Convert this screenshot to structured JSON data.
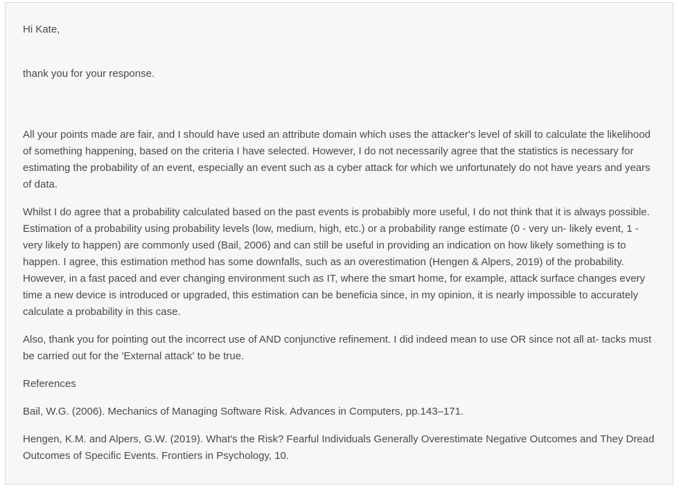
{
  "message": {
    "greeting": "Hi Kate,",
    "thanks": "thank you for your response.",
    "paragraph_1": "All your points made are fair, and I should have used an attribute domain which uses the attacker's level of skill to calculate the likelihood of something happening, based on the criteria I have selected. However, I do not necessarily agree that the statistics is necessary for estimating the probability of an event, especially an event such as a cyber attack for which we unfortunately do not have years and years of data.",
    "paragraph_2": "Whilst I do agree that a probability calculated based on the past events is probabibly more useful, I do not think that it is always possible. Estimation of a probability using probability levels (low, medium, high, etc.) or a probability range estimate (0 - very un- likely event, 1 - very likely to happen) are commonly used (Bail, 2006) and can still be useful in providing an indication on how likely something is to happen. I agree, this estimation method has some downfalls, such as an overestimation (Hengen & Alpers, 2019) of the probability. However, in a fast paced and ever changing environment such as IT, where the smart home, for example, attack surface changes every time a new device is introduced or upgraded, this estimation can be beneficia since, in my opinion, it is nearly impossible to accurately calculate a probability in this case.",
    "paragraph_3": "Also, thank you for pointing out the incorrect use of AND conjunctive refinement. I did indeed mean to use OR since not all at- tacks must be carried out for the 'External attack' to be true.",
    "references_heading": "References",
    "references": [
      "Bail, W.G. (2006). Mechanics of Managing Software Risk. Advances in Computers, pp.143–171.",
      "Hengen, K.M. and Alpers, G.W. (2019). What's the Risk? Fearful Individuals Generally Overestimate Negative Outcomes and They Dread Outcomes of Specific Events. Frontiers in Psychology, 10."
    ]
  }
}
